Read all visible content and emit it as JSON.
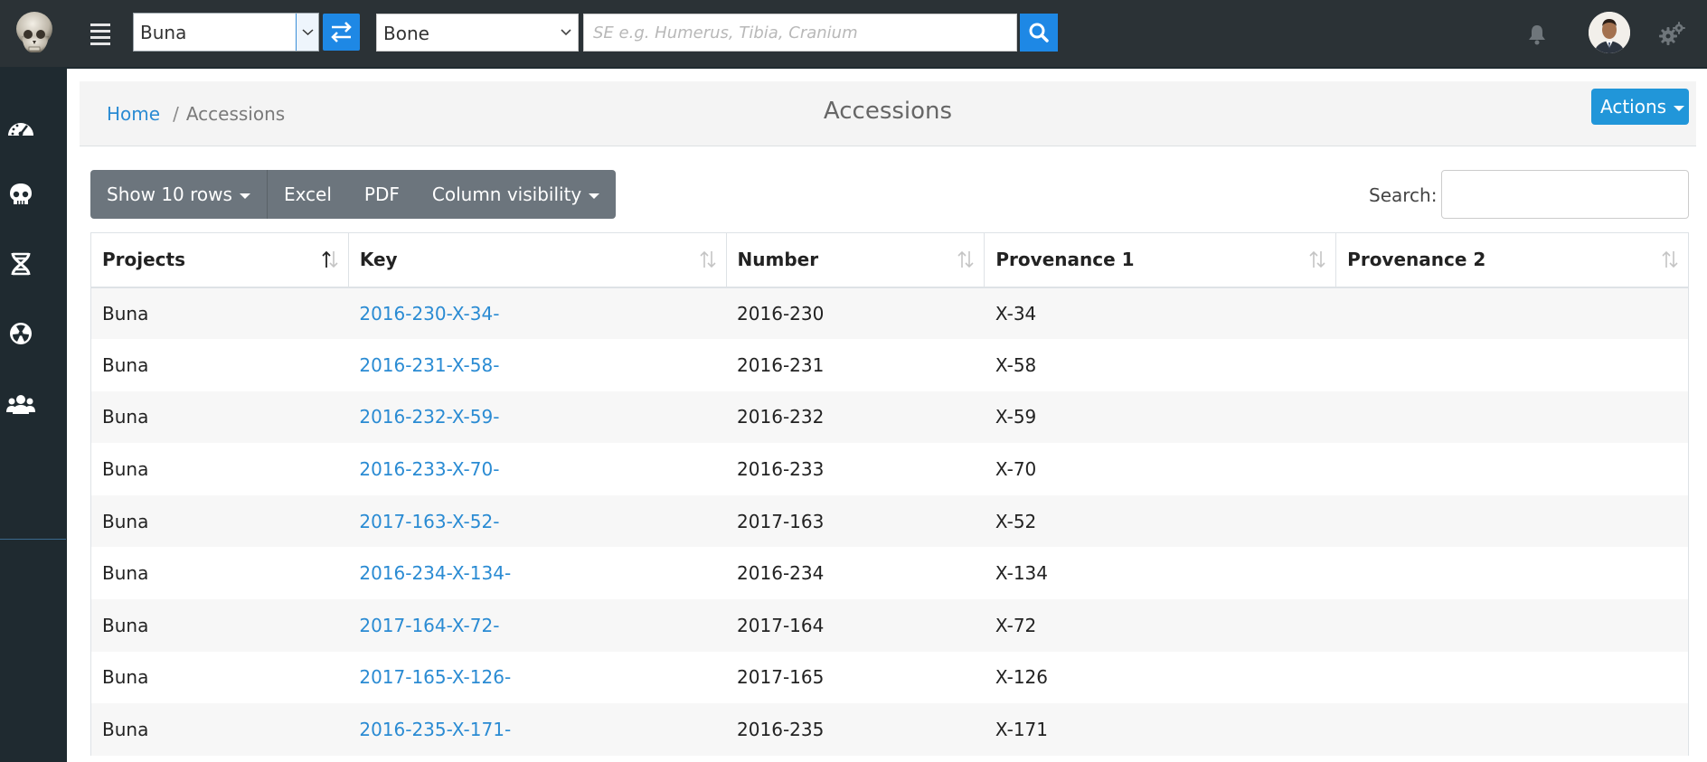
{
  "topbar": {
    "project_select_value": "Buna",
    "bone_select_value": "Bone",
    "search_placeholder": "SE e.g. Humerus, Tibia, Cranium"
  },
  "sidebar": {
    "items": [
      {
        "icon": "dashboard-icon"
      },
      {
        "icon": "skull-icon"
      },
      {
        "icon": "dna-icon"
      },
      {
        "icon": "radiation-icon"
      },
      {
        "icon": "users-icon"
      }
    ]
  },
  "breadcrumb": {
    "home": "Home",
    "sep": "/",
    "current": "Accessions"
  },
  "page": {
    "title": "Accessions",
    "actions_label": "Actions"
  },
  "toolbar": {
    "show_rows": "Show 10 rows",
    "excel": "Excel",
    "pdf": "PDF",
    "column_visibility": "Column visibility",
    "search_label": "Search:"
  },
  "table": {
    "headers": [
      "Projects",
      "Key",
      "Number",
      "Provenance 1",
      "Provenance 2"
    ],
    "rows": [
      {
        "project": "Buna",
        "key": "2016-230-X-34-",
        "number": "2016-230",
        "prov1": "X-34",
        "prov2": ""
      },
      {
        "project": "Buna",
        "key": "2016-231-X-58-",
        "number": "2016-231",
        "prov1": "X-58",
        "prov2": ""
      },
      {
        "project": "Buna",
        "key": "2016-232-X-59-",
        "number": "2016-232",
        "prov1": "X-59",
        "prov2": ""
      },
      {
        "project": "Buna",
        "key": "2016-233-X-70-",
        "number": "2016-233",
        "prov1": "X-70",
        "prov2": ""
      },
      {
        "project": "Buna",
        "key": "2017-163-X-52-",
        "number": "2017-163",
        "prov1": "X-52",
        "prov2": ""
      },
      {
        "project": "Buna",
        "key": "2016-234-X-134-",
        "number": "2016-234",
        "prov1": "X-134",
        "prov2": ""
      },
      {
        "project": "Buna",
        "key": "2017-164-X-72-",
        "number": "2017-164",
        "prov1": "X-72",
        "prov2": ""
      },
      {
        "project": "Buna",
        "key": "2017-165-X-126-",
        "number": "2017-165",
        "prov1": "X-126",
        "prov2": ""
      },
      {
        "project": "Buna",
        "key": "2016-235-X-171-",
        "number": "2016-235",
        "prov1": "X-171",
        "prov2": ""
      }
    ]
  },
  "colors": {
    "topbar": "#2b3236",
    "sidebar": "#1f2a30",
    "accent": "#1e88e5",
    "link": "#2a8bd3",
    "button_gray": "#6c757d"
  }
}
